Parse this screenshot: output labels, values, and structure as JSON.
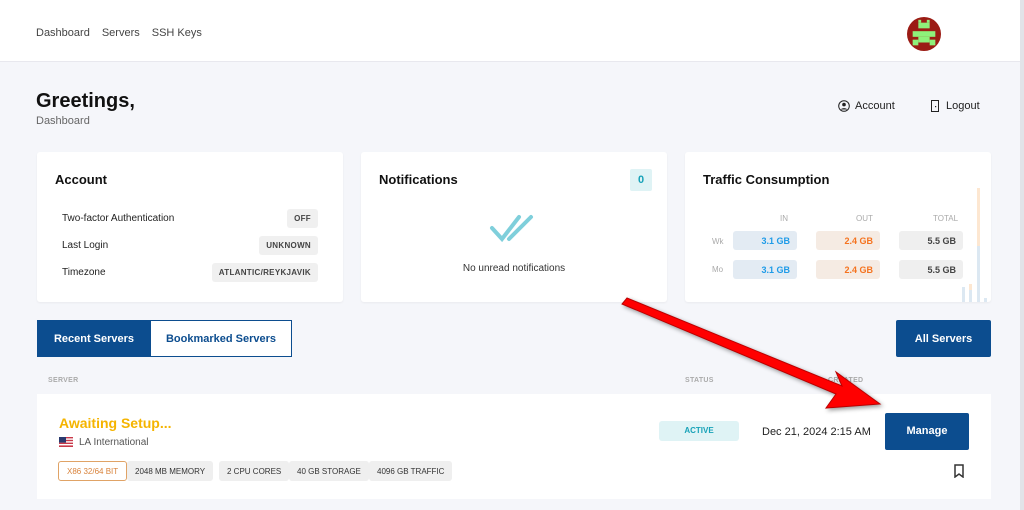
{
  "nav": {
    "items": [
      "Dashboard",
      "Servers",
      "SSH Keys"
    ]
  },
  "header": {
    "title": "Greetings,",
    "subtitle": "Dashboard",
    "account_label": "Account",
    "logout_label": "Logout"
  },
  "account_card": {
    "title": "Account",
    "rows": [
      {
        "label": "Two-factor Authentication",
        "value": "OFF"
      },
      {
        "label": "Last Login",
        "value": "UNKNOWN"
      },
      {
        "label": "Timezone",
        "value": "ATLANTIC/REYKJAVIK"
      }
    ]
  },
  "notifications": {
    "title": "Notifications",
    "count": "0",
    "empty_text": "No unread notifications"
  },
  "traffic": {
    "title": "Traffic Consumption",
    "headers": {
      "in": "IN",
      "out": "OUT",
      "total": "TOTAL"
    },
    "rows": [
      {
        "label": "Wk",
        "in": "3.1 GB",
        "out": "2.4 GB",
        "total": "5.5 GB"
      },
      {
        "label": "Mo",
        "in": "3.1 GB",
        "out": "2.4 GB",
        "total": "5.5 GB"
      }
    ],
    "colors": {
      "in": "#1e9be8",
      "out": "#f5731f",
      "total": "#444444"
    }
  },
  "tabs": {
    "recent": "Recent Servers",
    "bookmarked": "Bookmarked Servers",
    "all": "All Servers"
  },
  "columns": {
    "server": "SERVER",
    "status": "STATUS",
    "created": "CREATED"
  },
  "server": {
    "name": "Awaiting Setup...",
    "location": "LA International",
    "status": "ACTIVE",
    "created": "Dec 21, 2024 2:15 AM",
    "manage": "Manage",
    "tags": [
      "X86 32/64 BIT",
      "2048 MB MEMORY",
      "2 CPU CORES",
      "40 GB STORAGE",
      "4096 GB TRAFFIC"
    ]
  },
  "colors": {
    "primary": "#0c4d8f",
    "warning": "#f5b400",
    "status_bg": "#dff3f5",
    "status_fg": "#17a2b8",
    "annotation_arrow": "#ff0000"
  }
}
